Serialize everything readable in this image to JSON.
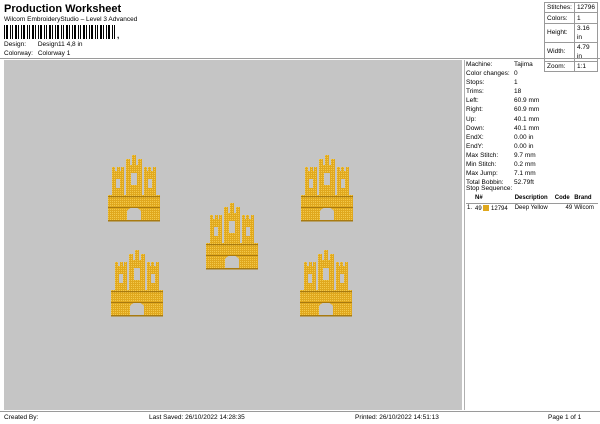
{
  "header": {
    "title": "Production Worksheet",
    "subtitle": "Wilcom EmbroideryStudio – Level 3 Advanced",
    "design_label": "Design:",
    "design_value": "Design11 4,8 in",
    "colorway_label": "Colorway:",
    "colorway_value": "Colorway 1"
  },
  "stats": [
    {
      "label": "Stitches:",
      "value": "12796"
    },
    {
      "label": "Colors:",
      "value": "1"
    },
    {
      "label": "Height:",
      "value": "3.16 in"
    },
    {
      "label": "Width:",
      "value": "4.79 in"
    },
    {
      "label": "Zoom:",
      "value": "1:1"
    }
  ],
  "properties": [
    {
      "label": "Machine:",
      "value": "Tajima"
    },
    {
      "label": "Color changes:",
      "value": "0"
    },
    {
      "label": "Stops:",
      "value": "1"
    },
    {
      "label": "Trims:",
      "value": "18"
    },
    {
      "label": "Left:",
      "value": "60.9 mm"
    },
    {
      "label": "Right:",
      "value": "60.9 mm"
    },
    {
      "label": "Up:",
      "value": "40.1 mm"
    },
    {
      "label": "Down:",
      "value": "40.1 mm"
    },
    {
      "label": "EndX:",
      "value": "0.00 in"
    },
    {
      "label": "EndY:",
      "value": "0.00 in"
    },
    {
      "label": "Max Stitch:",
      "value": "9.7 mm"
    },
    {
      "label": "Min Stitch:",
      "value": "0.2 mm"
    },
    {
      "label": "Max Jump:",
      "value": "7.1 mm"
    },
    {
      "label": "Total Bobbin:",
      "value": "52.79ft"
    }
  ],
  "stop_sequence": {
    "title": "Stop Sequence:",
    "columns": [
      "N#",
      "Description",
      "Code",
      "Brand"
    ],
    "rows": [
      {
        "stop": "1.",
        "needle": "49",
        "code_n": "12794",
        "description": "Deep Yellow",
        "code": "49",
        "brand": "Wilcom",
        "color": "#e0a81e"
      }
    ]
  },
  "design_color": "#e0a81e",
  "footer": {
    "created_by": "Created By:",
    "last_saved": "Last Saved: 26/10/2022 14:28:35",
    "printed": "Printed: 26/10/2022 14:51:13",
    "page": "Page 1 of 1"
  }
}
